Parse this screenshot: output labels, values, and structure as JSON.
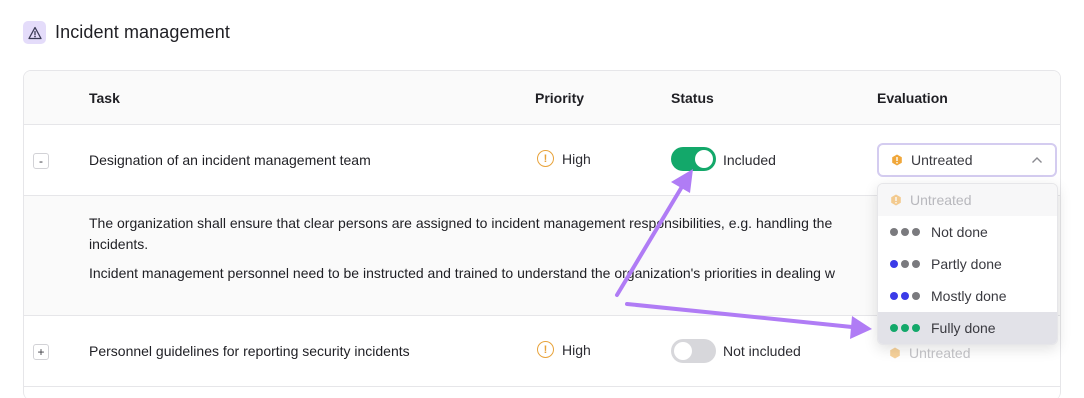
{
  "section": {
    "title": "Incident management",
    "icon": "warning-triangle-icon"
  },
  "table": {
    "headers": {
      "task": "Task",
      "priority": "Priority",
      "status": "Status",
      "evaluation": "Evaluation"
    }
  },
  "rows": [
    {
      "expand_symbol": "-",
      "task": "Designation of an incident management team",
      "priority": "High",
      "status_enabled": true,
      "status": "Included",
      "evaluation": "Untreated"
    },
    {
      "expand_symbol": "+",
      "task": "Personnel guidelines for reporting security incidents",
      "priority": "High",
      "status_enabled": false,
      "status": "Not included",
      "evaluation": "Untreated"
    }
  ],
  "description": {
    "paragraph1_line1": "The organization shall ensure that clear persons are assigned to incident management responsibilities, e.g. handling the",
    "paragraph1_line2": "incidents.",
    "paragraph2": "Incident management personnel need to be instructed and trained to understand the organization's priorities in dealing w"
  },
  "dropdown": {
    "options": [
      {
        "label": "Untreated",
        "state": "disabled"
      },
      {
        "label": "Not done",
        "dots": [
          "#7a7a7e",
          "#7a7a7e",
          "#7a7a7e"
        ]
      },
      {
        "label": "Partly done",
        "dots": [
          "#3b3be8",
          "#7a7a7e",
          "#7a7a7e"
        ]
      },
      {
        "label": "Mostly done",
        "dots": [
          "#3b3be8",
          "#3b3be8",
          "#7a7a7e"
        ]
      },
      {
        "label": "Fully done",
        "dots": [
          "#13a86a",
          "#13a86a",
          "#13a86a"
        ],
        "state": "selected"
      }
    ]
  },
  "colors": {
    "accent_purple": "#b07cf5",
    "toggle_on": "#13a86a",
    "priority_high": "#e8a33b",
    "untreated_hex": "#f0a73a"
  }
}
